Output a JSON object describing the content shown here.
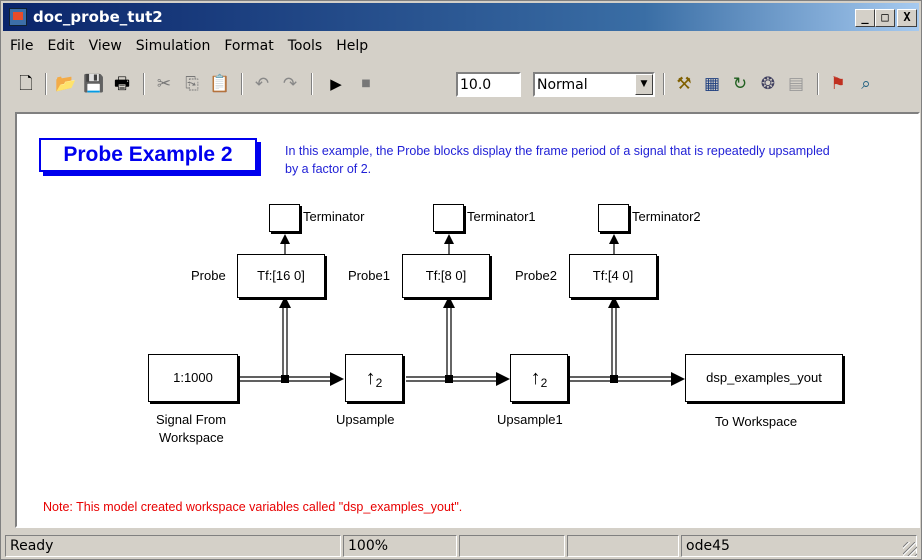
{
  "window": {
    "title": "doc_probe_tut2",
    "min": "_",
    "max": "□",
    "close": "X"
  },
  "menu": [
    "File",
    "Edit",
    "View",
    "Simulation",
    "Format",
    "Tools",
    "Help"
  ],
  "toolbar": {
    "stop_time": "10.0",
    "sim_mode": "Normal"
  },
  "diagram": {
    "title": "Probe  Example 2",
    "description": "In this example, the Probe blocks display the frame period of a signal that is repeatedly upsampled by a factor of 2.",
    "note": "Note: This model created workspace variables called \"dsp_examples_yout\".",
    "terminators": [
      "Terminator",
      "Terminator1",
      "Terminator2"
    ],
    "probes": [
      {
        "label": "Probe",
        "value": "Tf:[16 0]"
      },
      {
        "label": "Probe1",
        "value": "Tf:[8 0]"
      },
      {
        "label": "Probe2",
        "value": "Tf:[4 0]"
      }
    ],
    "source": {
      "value": "1:1000",
      "label_line1": "Signal From",
      "label_line2": "Workspace"
    },
    "upsamples": [
      {
        "symbol": "↑",
        "factor": "2",
        "label": "Upsample"
      },
      {
        "symbol": "↑",
        "factor": "2",
        "label": "Upsample1"
      }
    ],
    "sink": {
      "value": "dsp_examples_yout",
      "label": "To Workspace"
    }
  },
  "status": {
    "state": "Ready",
    "zoom": "100%",
    "solver": "ode45"
  }
}
